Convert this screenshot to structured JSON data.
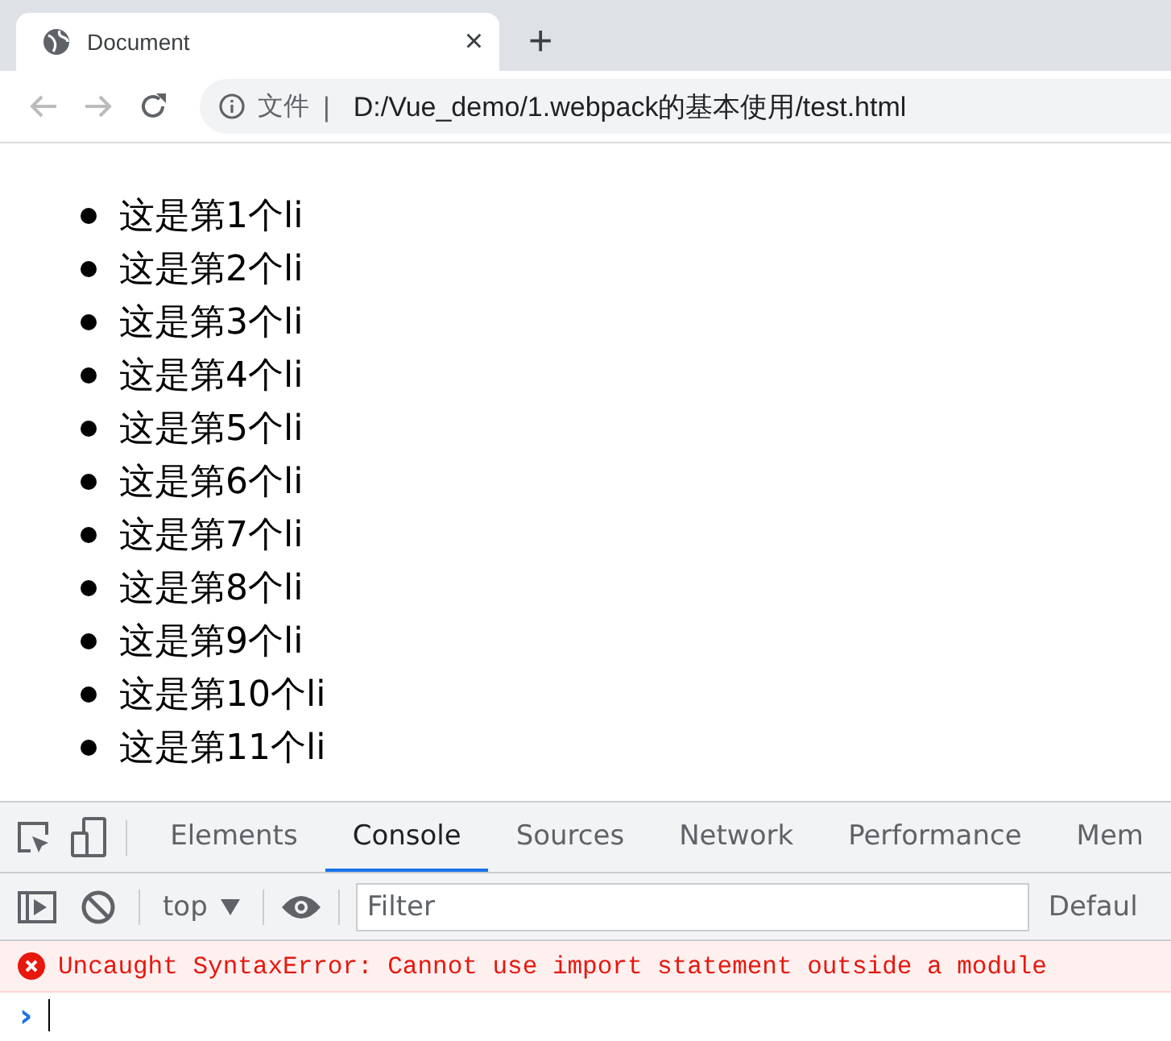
{
  "browser_tab": {
    "title": "Document",
    "close": "×",
    "new_tab": "+"
  },
  "address_bar": {
    "security_label": "文件",
    "separator": "|",
    "url": "D:/Vue_demo/1.webpack的基本使用/test.html"
  },
  "page": {
    "list_items": [
      "这是第1个li",
      "这是第2个li",
      "这是第3个li",
      "这是第4个li",
      "这是第5个li",
      "这是第6个li",
      "这是第7个li",
      "这是第8个li",
      "这是第9个li",
      "这是第10个li",
      "这是第11个li"
    ]
  },
  "devtools": {
    "tabs": [
      {
        "label": "Elements",
        "selected": false
      },
      {
        "label": "Console",
        "selected": true
      },
      {
        "label": "Sources",
        "selected": false
      },
      {
        "label": "Network",
        "selected": false
      },
      {
        "label": "Performance",
        "selected": false
      },
      {
        "label": "Mem",
        "selected": false
      }
    ],
    "context": "top",
    "filter": {
      "placeholder": "Filter"
    },
    "levels": "Defaul",
    "messages": [
      {
        "kind": "error",
        "text": "Uncaught SyntaxError: Cannot use import statement outside a module"
      }
    ],
    "prompt": "›"
  }
}
